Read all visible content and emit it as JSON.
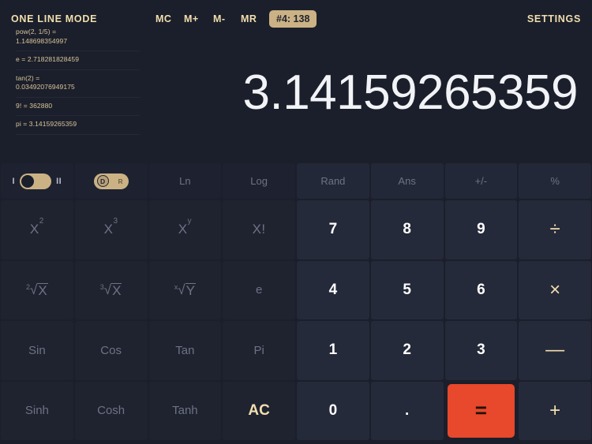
{
  "topbar": {
    "mode_title": "ONE LINE MODE",
    "memory_buttons": [
      {
        "name": "memory-clear",
        "label": "MC"
      },
      {
        "name": "memory-add",
        "label": "M+"
      },
      {
        "name": "memory-subtract",
        "label": "M-"
      },
      {
        "name": "memory-recall",
        "label": "MR"
      }
    ],
    "memory_badge": "#4: 138",
    "settings_label": "SETTINGS"
  },
  "history": {
    "entries": [
      "pow(2, 1/5) =\n1.148698354997",
      "e = 2.718281828459",
      "tan(2) =\n0.03492076949175",
      "9! = 362880",
      "pi = 3.14159265359"
    ]
  },
  "display": {
    "value": "3.14159265359"
  },
  "toggles": {
    "line_mode": {
      "left_label": "I",
      "right_label": "II",
      "state": "left"
    },
    "angle_mode": {
      "on_label": "D",
      "off_label": "R",
      "state": "D"
    }
  },
  "keypad": {
    "row_functions": [
      "Ln",
      "Log",
      "Rand",
      "Ans",
      "+/-",
      "%"
    ],
    "rows": [
      [
        "X2",
        "X3",
        "XY",
        "X!",
        "7",
        "8",
        "9",
        "÷"
      ],
      [
        "2rootX",
        "3rootX",
        "XrootY",
        "e",
        "4",
        "5",
        "6",
        "×"
      ],
      [
        "Sin",
        "Cos",
        "Tan",
        "Pi",
        "1",
        "2",
        "3",
        "—"
      ],
      [
        "Sinh",
        "Cosh",
        "Tanh",
        "AC",
        "0",
        ".",
        "=",
        "+"
      ]
    ],
    "labels": {
      "x_squared_base": "X",
      "x_squared_exp": "2",
      "x_cubed_base": "X",
      "x_cubed_exp": "3",
      "x_pow_y_base": "X",
      "x_pow_y_exp": "y",
      "x_factorial": "X!",
      "sqrt_index": "2",
      "sqrt_arg": "X",
      "cbrt_index": "3",
      "cbrt_arg": "X",
      "nthroot_index": "x",
      "nthroot_arg": "Y",
      "radical_symbol": "√",
      "euler": "e",
      "sin": "Sin",
      "cos": "Cos",
      "tan": "Tan",
      "pi": "Pi",
      "sinh": "Sinh",
      "cosh": "Cosh",
      "tanh": "Tanh",
      "all_clear": "AC",
      "d7": "7",
      "d8": "8",
      "d9": "9",
      "d4": "4",
      "d5": "5",
      "d6": "6",
      "d1": "1",
      "d2": "2",
      "d3": "3",
      "d0": "0",
      "decimal": ".",
      "divide": "÷",
      "multiply": "×",
      "subtract": "—",
      "add": "+",
      "equals": "="
    }
  },
  "colors": {
    "background": "#1b1f2b",
    "key_left": "#1f2330",
    "key_right": "#252a3a",
    "accent_gold": "#f2dfae",
    "badge_bg": "#cbb285",
    "equals_bg": "#e8482b",
    "digit_white": "#ffffff",
    "muted_text": "#6d7385"
  }
}
